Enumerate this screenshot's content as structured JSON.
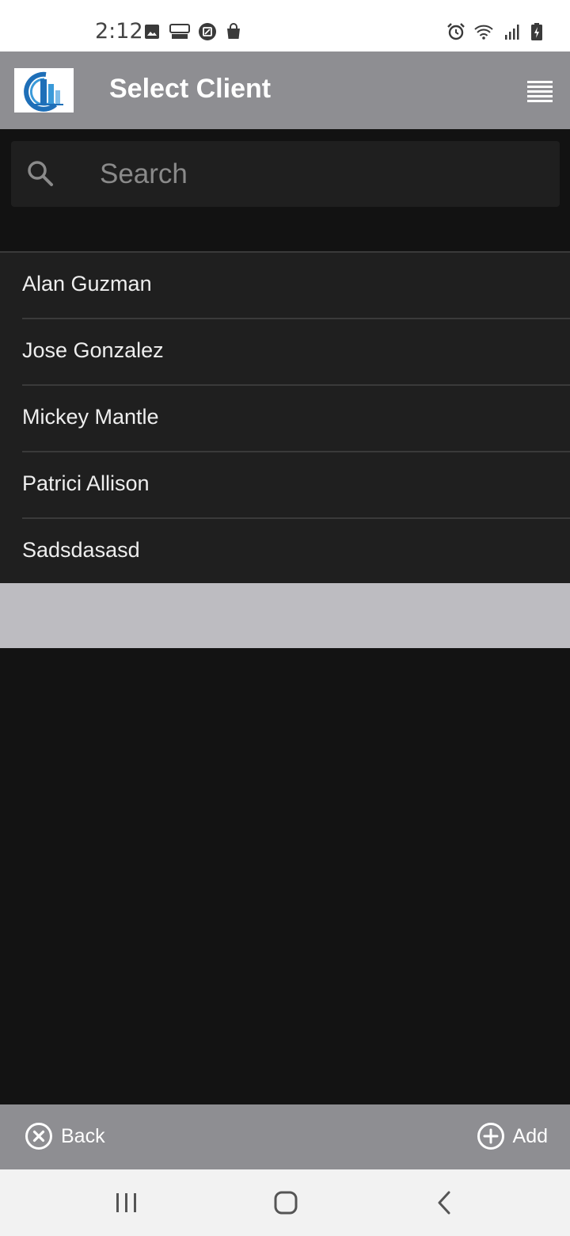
{
  "status_bar": {
    "time": "2:12",
    "left_icons": [
      "image-icon",
      "blast-icon",
      "nfc-icon",
      "shopping-bag-icon"
    ],
    "right_icons": [
      "alarm-icon",
      "wifi-icon",
      "signal-icon",
      "battery-charging-icon"
    ]
  },
  "header": {
    "title": "Select Client",
    "logo": "building-logo",
    "menu_icon": "hamburger-menu-icon"
  },
  "search": {
    "placeholder": "Search",
    "value": ""
  },
  "clients": [
    {
      "name": "Alan Guzman"
    },
    {
      "name": "Jose Gonzalez"
    },
    {
      "name": "Mickey Mantle"
    },
    {
      "name": "Patrici Allison"
    },
    {
      "name": "Sadsdasasd"
    }
  ],
  "footer": {
    "back_label": "Back",
    "add_label": "Add"
  },
  "colors": {
    "header_bg": "#8e8e92",
    "page_bg": "#131313",
    "list_bg": "#1f1f1f",
    "band_bg": "#bdbcc1",
    "nav_bg": "#f2f2f2"
  }
}
